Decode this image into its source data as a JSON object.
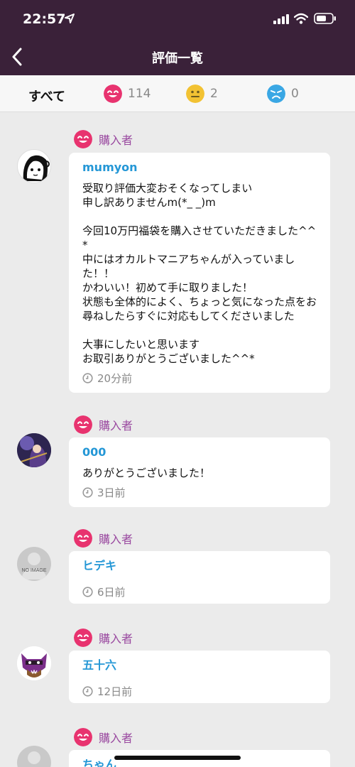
{
  "status_bar": {
    "time": "22:57"
  },
  "nav": {
    "title": "評価一覧"
  },
  "filters": {
    "all_label": "すべて",
    "good_count": "114",
    "normal_count": "2",
    "bad_count": "0"
  },
  "colors": {
    "header_bg": "#3a2139",
    "accent_pink": "#e8336f",
    "name_blue": "#2497d6",
    "badge_purple": "#9a4aa0"
  },
  "reviews": [
    {
      "badge": "購入者",
      "user": "mumyon",
      "comment": "受取り評価大変おそくなってしまい\n申し訳ありませんm(*_ _)m\n\n今回10万円福袋を購入させていただきました^^*\n中にはオカルトマニアちゃんが入っていました！！\nかわいい！初めて手に取りました！\n状態も全体的によく、ちょっと気になった点をお尋ねしたらすぐに対応もしてくださいました\n\n大事にしたいと思います\nお取引ありがとうございました^^*",
      "time": "20分前"
    },
    {
      "badge": "購入者",
      "user": "000",
      "comment": "ありがとうございました！",
      "time": "3日前"
    },
    {
      "badge": "購入者",
      "user": "ヒデキ",
      "comment": "",
      "time": "6日前",
      "avatar_text": "NO IMAGE"
    },
    {
      "badge": "購入者",
      "user": "五十六",
      "comment": "",
      "time": "12日前"
    },
    {
      "badge": "購入者",
      "user": "ちゃん"
    }
  ]
}
